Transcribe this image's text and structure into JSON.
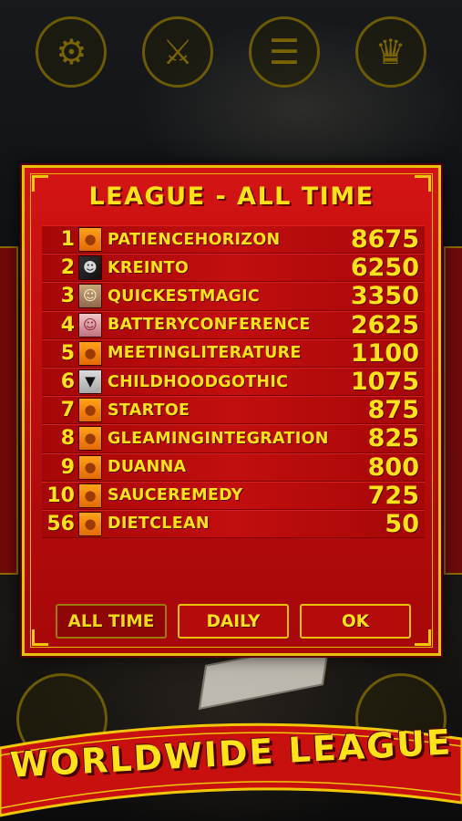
{
  "top_icons": [
    {
      "name": "settings-gear-icon",
      "glyph": "⚙"
    },
    {
      "name": "crossed-swords-icon",
      "glyph": "⚔"
    },
    {
      "name": "leaderboard-trophy-icon",
      "glyph": "☰"
    },
    {
      "name": "trophy-podium-icon",
      "glyph": "🏆"
    }
  ],
  "dialog": {
    "title": "LEAGUE - ALL TIME",
    "rows": [
      {
        "rank": "1",
        "avatar": "default",
        "name": "PATIENCEHORIZON",
        "score": "8675"
      },
      {
        "rank": "2",
        "avatar": "photo-dark",
        "name": "KREINTO",
        "score": "6250"
      },
      {
        "rank": "3",
        "avatar": "photo-blonde",
        "name": "QUICKESTMAGIC",
        "score": "3350"
      },
      {
        "rank": "4",
        "avatar": "photo-pink",
        "name": "BATTERYCONFERENCE",
        "score": "2625"
      },
      {
        "rank": "5",
        "avatar": "default",
        "name": "MEETINGLITERATURE",
        "score": "1100"
      },
      {
        "rank": "6",
        "avatar": "photo-bat",
        "name": "CHILDHOODGOTHIC",
        "score": "1075"
      },
      {
        "rank": "7",
        "avatar": "default",
        "name": "STARTOE",
        "score": "875"
      },
      {
        "rank": "8",
        "avatar": "default",
        "name": "GLEAMINGINTEGRATION",
        "score": "825"
      },
      {
        "rank": "9",
        "avatar": "default",
        "name": "DUANNA",
        "score": "800"
      },
      {
        "rank": "10",
        "avatar": "default",
        "name": "SAUCEREMEDY",
        "score": "725"
      },
      {
        "rank": "56",
        "avatar": "default",
        "name": "DIETCLEAN",
        "score": "50"
      }
    ],
    "buttons": {
      "all_time": "ALL TIME",
      "daily": "DAILY",
      "ok": "OK"
    }
  },
  "banner": {
    "text": "WORLDWIDE LEAGUE"
  },
  "colors": {
    "panel_red": "#c20e0e",
    "gold_text": "#ffe21a",
    "gold_border": "#e8c20a"
  }
}
